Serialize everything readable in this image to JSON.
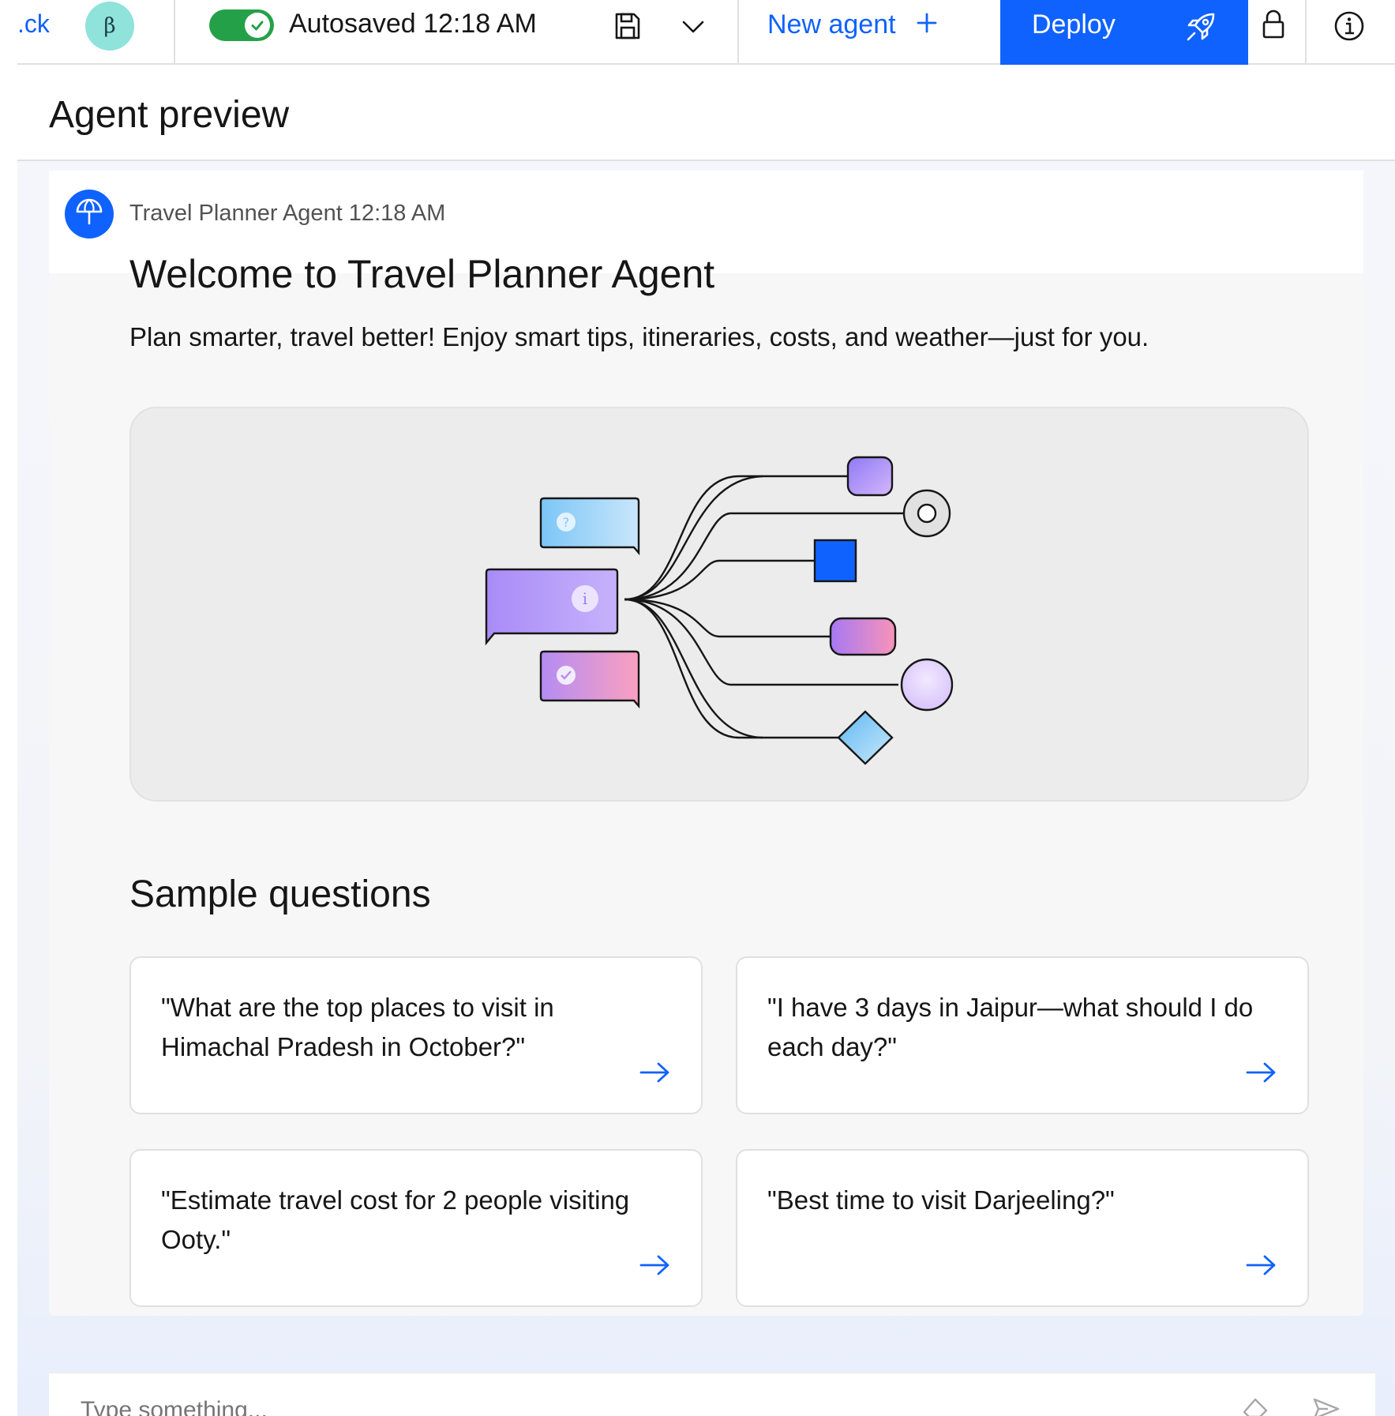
{
  "topbar": {
    "back_label": ".ck",
    "beta_badge": "β",
    "autosave_text": "Autosaved 12:18 AM",
    "new_agent_label": "New agent",
    "deploy_label": "Deploy",
    "icons": [
      "check-icon",
      "save-icon",
      "chevron-down-icon",
      "plus-icon",
      "rocket-icon",
      "lock-icon",
      "info-icon"
    ]
  },
  "preview": {
    "title": "Agent preview"
  },
  "message": {
    "agent_meta": "Travel Planner Agent 12:18 AM",
    "welcome_title": "Welcome to Travel Planner Agent",
    "welcome_desc": "Plan smarter, travel better! Enjoy smart tips, itineraries, costs, and weather—just for you."
  },
  "sample_questions": {
    "title": "Sample questions",
    "items": [
      "\"What are the top places to visit in Himachal Pradesh in October?\"",
      "\"I have 3 days in Jaipur—what should I do each day?\"",
      "\"Estimate travel cost for 2 people visiting Ooty.\"",
      "\"Best time to visit Darjeeling?\""
    ]
  },
  "composer": {
    "placeholder": "Type something..."
  },
  "colors": {
    "accent": "#0f62fe",
    "toggle_on": "#24a148",
    "beta_badge": "#8fe3db"
  }
}
